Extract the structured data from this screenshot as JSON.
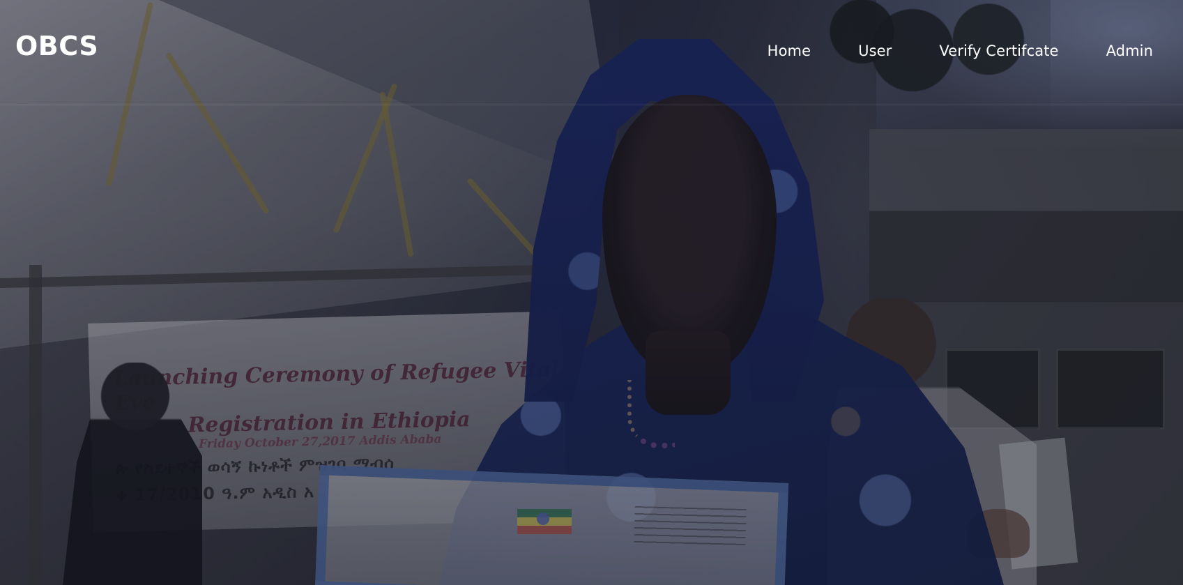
{
  "brand": {
    "name": "OBCS"
  },
  "navigation": [
    "Home",
    "User",
    "Verify Certifcate",
    "Admin"
  ],
  "hero": {
    "banner_lines": [
      "Launching Ceremony of Refugee Vital Eve",
      "Registration in Ethiopia",
      "Friday October 27,2017 Addis Ababa",
      "ጵ የስደተኞች ወሳኝ ኩነቶች ምዝገባ ማብሰ",
      "ቀ 17/2010 ዓ.ም አዲስ አ"
    ]
  }
}
